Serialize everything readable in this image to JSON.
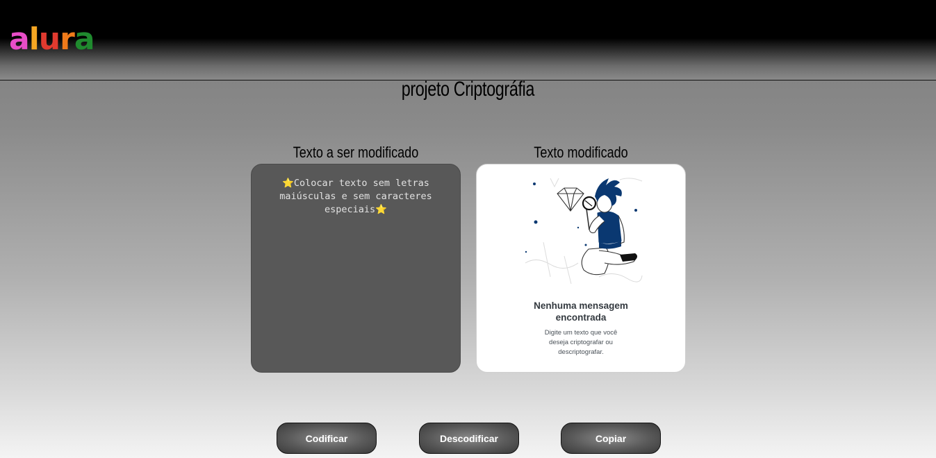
{
  "header": {
    "logo_letters": [
      {
        "char": "a",
        "color": "#e84dc8"
      },
      {
        "char": "l",
        "color": "#f5a623"
      },
      {
        "char": "u",
        "color": "#e03a2f"
      },
      {
        "char": "r",
        "color": "#f07a1a"
      },
      {
        "char": "a",
        "color": "#1f8a2e"
      }
    ]
  },
  "main": {
    "title": "projeto Criptográfia",
    "input_column": {
      "title": "Texto a ser modificado",
      "placeholder": "⭐Colocar texto sem letras maiúsculas e sem caracteres especiais⭐",
      "value": ""
    },
    "output_column": {
      "title": "Texto modificado",
      "empty_title": "Nenhuma mensagem encontrada",
      "empty_text": "Digite um texto que você deseja criptografar ou descriptografar."
    }
  },
  "buttons": {
    "encode_label": "Codificar",
    "decode_label": "Descodificar",
    "copy_label": "Copiar"
  },
  "colors": {
    "header_bg": "#000000",
    "input_bg": "#585858",
    "output_bg": "#ffffff",
    "illustration_accent": "#0a3871"
  }
}
